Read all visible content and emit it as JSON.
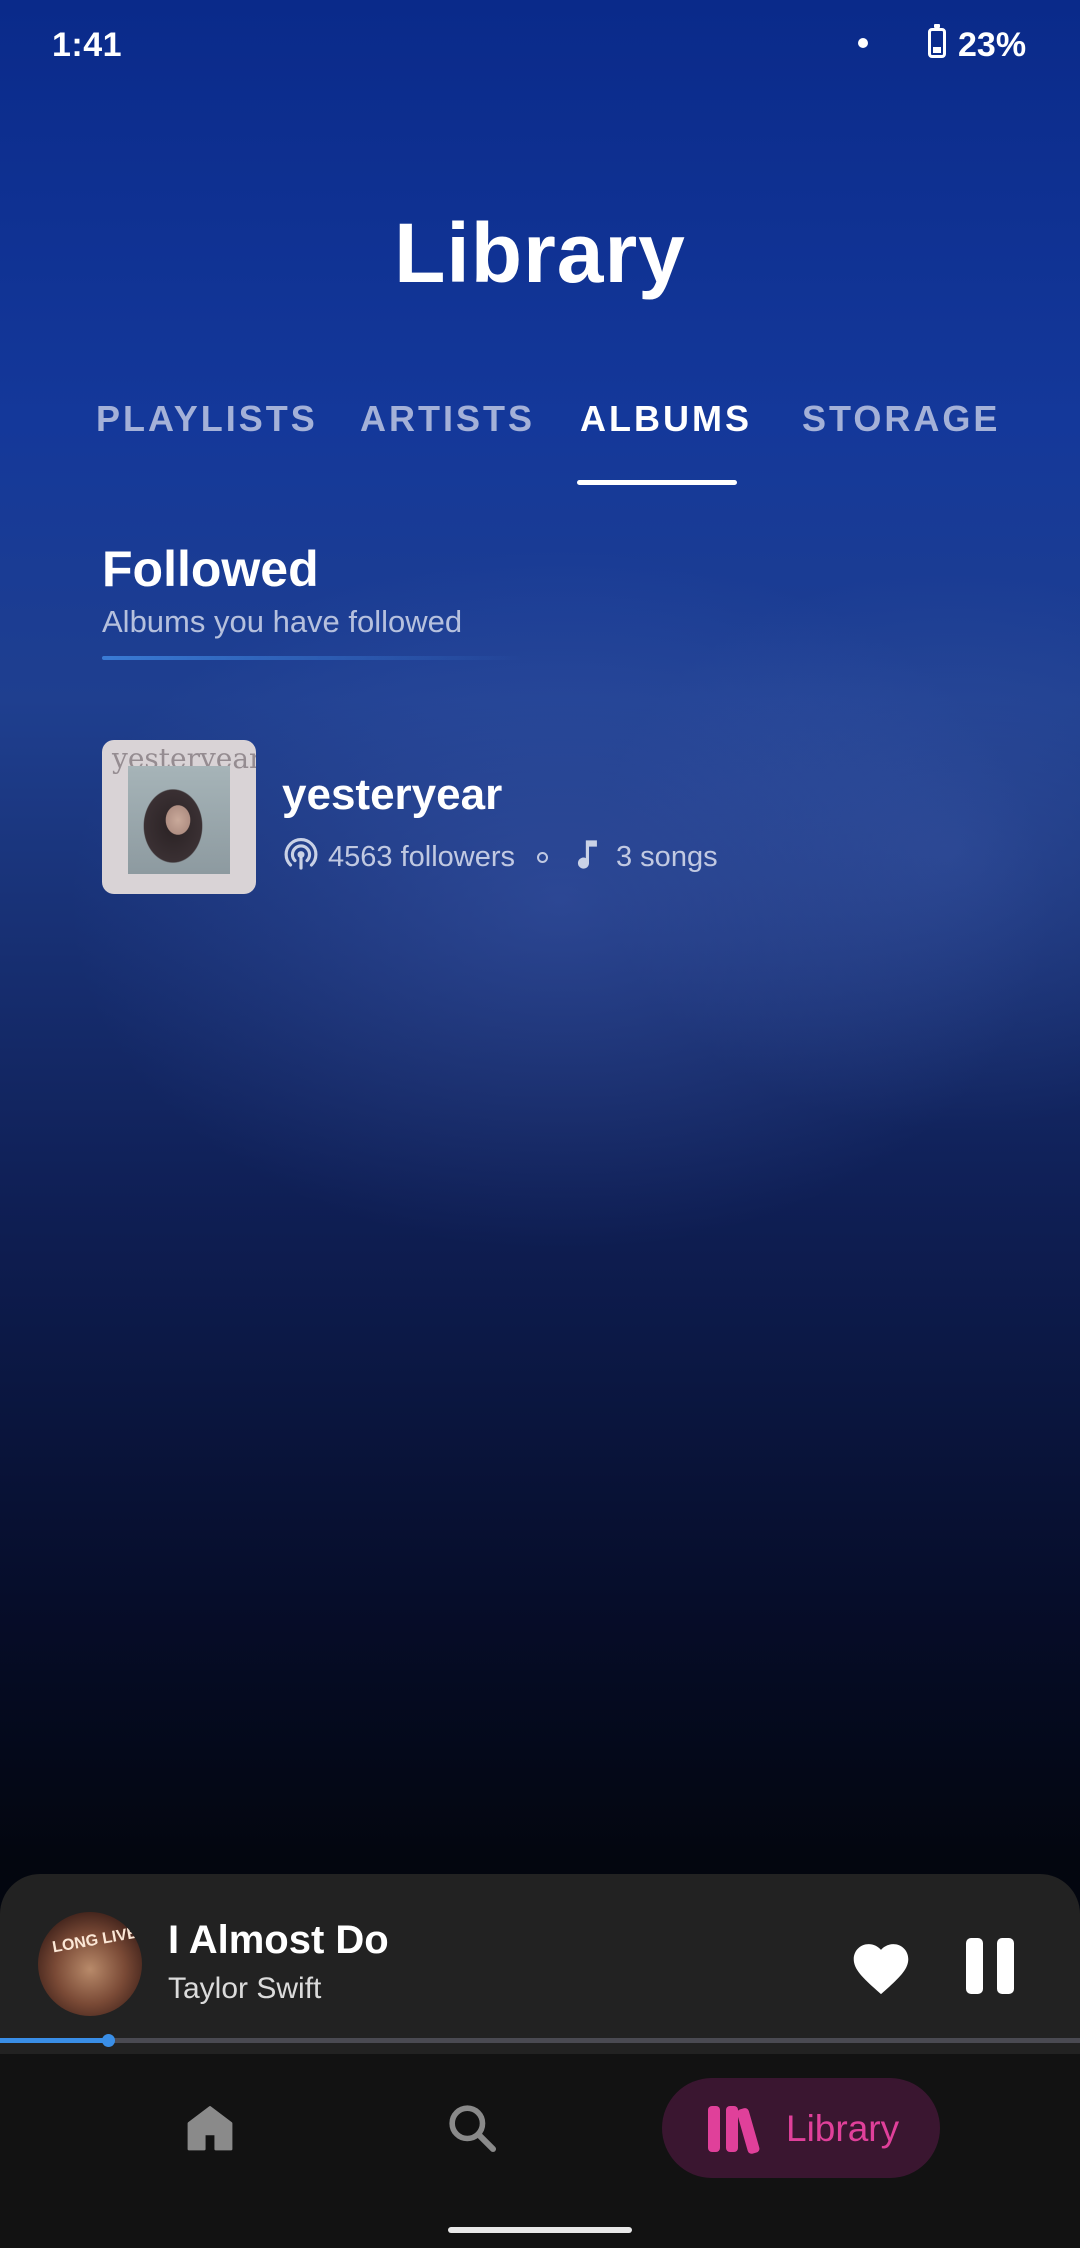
{
  "status_bar": {
    "time": "1:41",
    "battery": "23%"
  },
  "header": {
    "title": "Library"
  },
  "tabs": [
    {
      "label": "PLAYLISTS",
      "active": false
    },
    {
      "label": "ARTISTS",
      "active": false
    },
    {
      "label": "ALBUMS",
      "active": true
    },
    {
      "label": "STORAGE",
      "active": false
    }
  ],
  "section": {
    "title": "Followed",
    "subtitle": "Albums you have followed"
  },
  "albums": [
    {
      "cover_text": "yesteryear",
      "name": "yesteryear",
      "followers": "4563 followers",
      "songs": "3 songs"
    }
  ],
  "now_playing": {
    "title": "I Almost Do",
    "artist": "Taylor Swift",
    "cover_text": "LONG LIVE",
    "progress": 0.1,
    "liked": true
  },
  "bottom_nav": {
    "items": [
      {
        "icon": "home-icon"
      },
      {
        "icon": "search-icon"
      },
      {
        "icon": "library-icon",
        "label": "Library",
        "active": true
      }
    ]
  },
  "colors": {
    "accent": "#e0409a",
    "progress": "#3a8ee6",
    "tab_indicator": "#ffffff"
  }
}
